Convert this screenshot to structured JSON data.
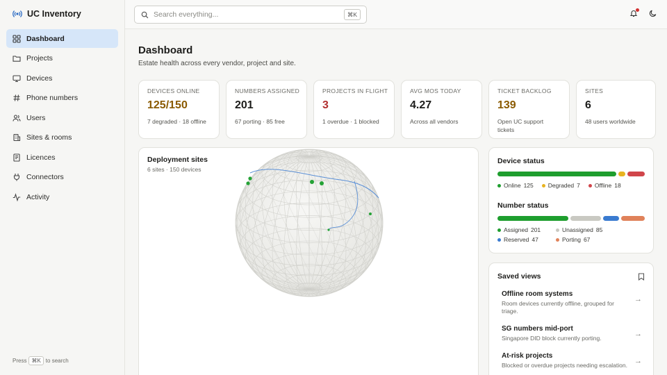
{
  "app": {
    "title": "UC Inventory",
    "logo_icon": "broadcast-icon"
  },
  "sidebar": {
    "items": [
      {
        "label": "Dashboard",
        "icon": "grid-icon",
        "active": true
      },
      {
        "label": "Projects",
        "icon": "folder-icon",
        "active": false
      },
      {
        "label": "Devices",
        "icon": "monitor-icon",
        "active": false
      },
      {
        "label": "Phone numbers",
        "icon": "hash-icon",
        "active": false
      },
      {
        "label": "Users",
        "icon": "users-icon",
        "active": false
      },
      {
        "label": "Sites & rooms",
        "icon": "building-icon",
        "active": false
      },
      {
        "label": "Licences",
        "icon": "license-icon",
        "active": false
      },
      {
        "label": "Connectors",
        "icon": "plug-icon",
        "active": false
      },
      {
        "label": "Activity",
        "icon": "activity-icon",
        "active": false
      }
    ],
    "footer": {
      "press": "Press",
      "shortcut": "⌘K",
      "to_search": "to search"
    }
  },
  "topbar": {
    "search_placeholder": "Search everything...",
    "search_shortcut": "⌘K",
    "notification_dot_color": "#d23030"
  },
  "page": {
    "title": "Dashboard",
    "subtitle": "Estate health across every vendor, project and site."
  },
  "kpis": [
    {
      "label": "DEVICES ONLINE",
      "value": "125/150",
      "note": "7 degraded · 18 offline",
      "tone": "warn"
    },
    {
      "label": "NUMBERS ASSIGNED",
      "value": "201",
      "note": "67 porting · 85 free",
      "tone": "normal"
    },
    {
      "label": "PROJECTS IN FLIGHT",
      "value": "3",
      "note": "1 overdue · 1 blocked",
      "tone": "danger"
    },
    {
      "label": "AVG MOS TODAY",
      "value": "4.27",
      "note": "Across all vendors",
      "tone": "normal"
    },
    {
      "label": "TICKET BACKLOG",
      "value": "139",
      "note": "Open UC support tickets",
      "tone": "amber"
    },
    {
      "label": "SITES",
      "value": "6",
      "note": "48 users worldwide",
      "tone": "normal"
    }
  ],
  "map": {
    "title": "Deployment sites",
    "subtitle": "6 sites · 150 devices"
  },
  "device_status": {
    "title": "Device status",
    "segments": [
      {
        "label": "Online",
        "value": 125,
        "color": "#1e9e2e"
      },
      {
        "label": "Degraded",
        "value": 7,
        "color": "#e8b320"
      },
      {
        "label": "Offline",
        "value": 18,
        "color": "#d0454a"
      }
    ]
  },
  "number_status": {
    "title": "Number status",
    "segments": [
      {
        "label": "Assigned",
        "value": 201,
        "color": "#1e9e2e"
      },
      {
        "label": "Unassigned",
        "value": 85,
        "color": "#c9c9c2"
      },
      {
        "label": "Reserved",
        "value": 47,
        "color": "#3a7bd0"
      },
      {
        "label": "Porting",
        "value": 67,
        "color": "#e0825a"
      }
    ]
  },
  "saved_views": {
    "title": "Saved views",
    "items": [
      {
        "title": "Offline room systems",
        "desc": "Room devices currently offline, grouped for triage."
      },
      {
        "title": "SG numbers mid-port",
        "desc": "Singapore DID block currently porting."
      },
      {
        "title": "At-risk projects",
        "desc": "Blocked or overdue projects needing escalation."
      }
    ]
  }
}
